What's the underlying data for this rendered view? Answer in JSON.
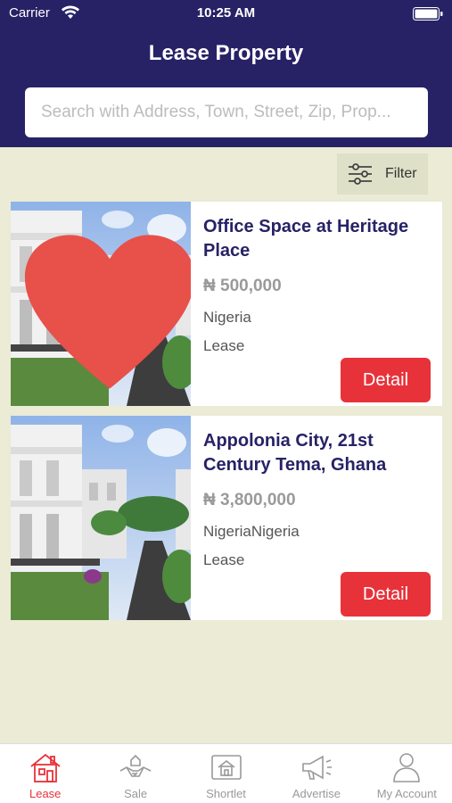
{
  "status_bar": {
    "carrier": "Carrier",
    "time": "10:25 AM"
  },
  "header": {
    "title": "Lease Property"
  },
  "search": {
    "placeholder": "Search with Address, Town, Street, Zip, Prop..."
  },
  "filter": {
    "label": "Filter"
  },
  "listings": [
    {
      "title": "Office Space at Heritage Place",
      "price": "₦ 500,000",
      "location": "Nigeria",
      "type": "Lease",
      "detail_label": "Detail",
      "favorited": true
    },
    {
      "title": "Appolonia City, 21st Century Tema, Ghana",
      "price": "₦ 3,800,000",
      "location": "NigeriaNigeria",
      "type": "Lease",
      "detail_label": "Detail",
      "favorited": false
    }
  ],
  "tabs": [
    {
      "label": "Lease",
      "icon": "house-icon",
      "active": true
    },
    {
      "label": "Sale",
      "icon": "handshake-icon",
      "active": false
    },
    {
      "label": "Shortlet",
      "icon": "house-frame-icon",
      "active": false
    },
    {
      "label": "Advertise",
      "icon": "megaphone-icon",
      "active": false
    },
    {
      "label": "My Account",
      "icon": "user-icon",
      "active": false
    }
  ],
  "colors": {
    "header_bg": "#272266",
    "accent_red": "#e8323a",
    "page_bg": "#ebebd6",
    "title_navy": "#272266"
  }
}
